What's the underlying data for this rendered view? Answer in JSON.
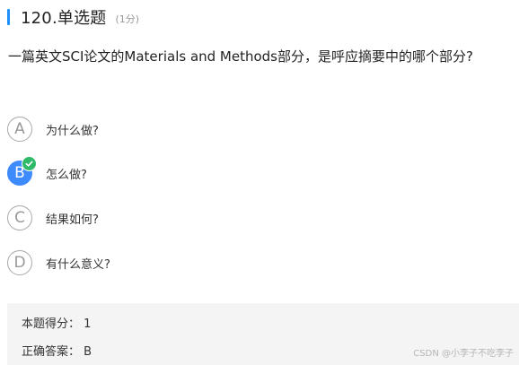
{
  "question": {
    "title": "120.单选题",
    "score": "(1分)",
    "text": "一篇英文SCI论文的Materials and Methods部分，是呼应摘要中的哪个部分?"
  },
  "options": [
    {
      "letter": "A",
      "label": "为什么做?",
      "selected": false
    },
    {
      "letter": "B",
      "label": "怎么做?",
      "selected": true
    },
    {
      "letter": "C",
      "label": "结果如何?",
      "selected": false
    },
    {
      "letter": "D",
      "label": "有什么意义?",
      "selected": false
    }
  ],
  "result": {
    "score_line": "本题得分：  1",
    "answer_line": "正确答案：  B"
  },
  "watermark": "CSDN @小李子不吃李子",
  "colors": {
    "accent": "#1e90ff",
    "selected": "#3d8bff",
    "check": "#2fba6a",
    "panel": "#f4f4f4"
  }
}
